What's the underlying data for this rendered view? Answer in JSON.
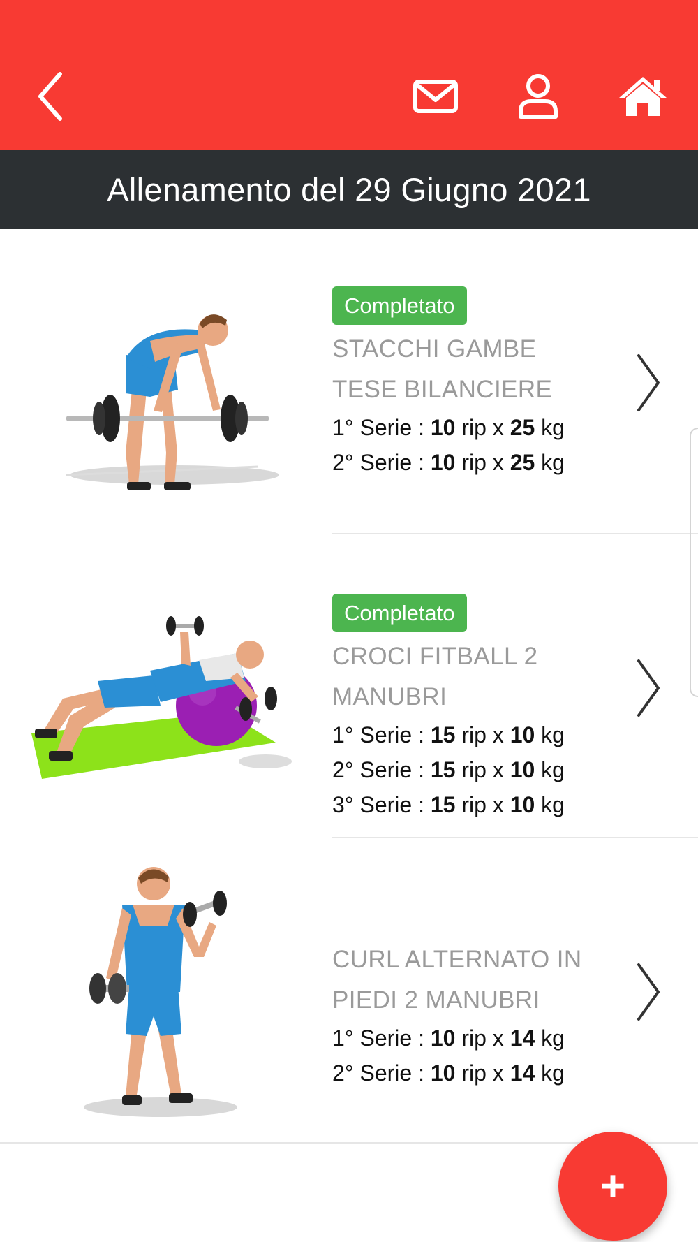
{
  "header": {
    "icons": {
      "back": "back-arrow-icon",
      "mail": "mail-icon",
      "profile": "user-icon",
      "home": "home-icon"
    },
    "colors": {
      "primary": "#f83a33",
      "titlebar": "#2c3033",
      "badge": "#4cb54f"
    }
  },
  "title": "Allenamento del 29 Giugno 2021",
  "exercises": [
    {
      "status": "Completato",
      "name_line1": "STACCHI GAMBE",
      "name_line2": "TESE BILANCIERE",
      "series": [
        {
          "label": "1° Serie : ",
          "reps": "10",
          "rip": " rip x ",
          "kg": "25",
          "unit": " kg"
        },
        {
          "label": "2° Serie : ",
          "reps": "10",
          "rip": " rip x ",
          "kg": "25",
          "unit": " kg"
        }
      ]
    },
    {
      "status": "Completato",
      "name_line1": "CROCI FITBALL 2",
      "name_line2": "MANUBRI",
      "series": [
        {
          "label": "1° Serie : ",
          "reps": "15",
          "rip": " rip x ",
          "kg": "10",
          "unit": " kg"
        },
        {
          "label": "2° Serie : ",
          "reps": "15",
          "rip": " rip x ",
          "kg": "10",
          "unit": " kg"
        },
        {
          "label": "3° Serie : ",
          "reps": "15",
          "rip": " rip x ",
          "kg": "10",
          "unit": " kg"
        }
      ]
    },
    {
      "status": "",
      "name_line1": "CURL ALTERNATO IN",
      "name_line2": "PIEDI 2 MANUBRI",
      "series": [
        {
          "label": "1° Serie : ",
          "reps": "10",
          "rip": " rip x ",
          "kg": "14",
          "unit": " kg"
        },
        {
          "label": "2° Serie : ",
          "reps": "10",
          "rip": " rip x ",
          "kg": "14",
          "unit": " kg"
        }
      ]
    }
  ],
  "fab": {
    "label": "+",
    "icon": "plus-icon"
  }
}
